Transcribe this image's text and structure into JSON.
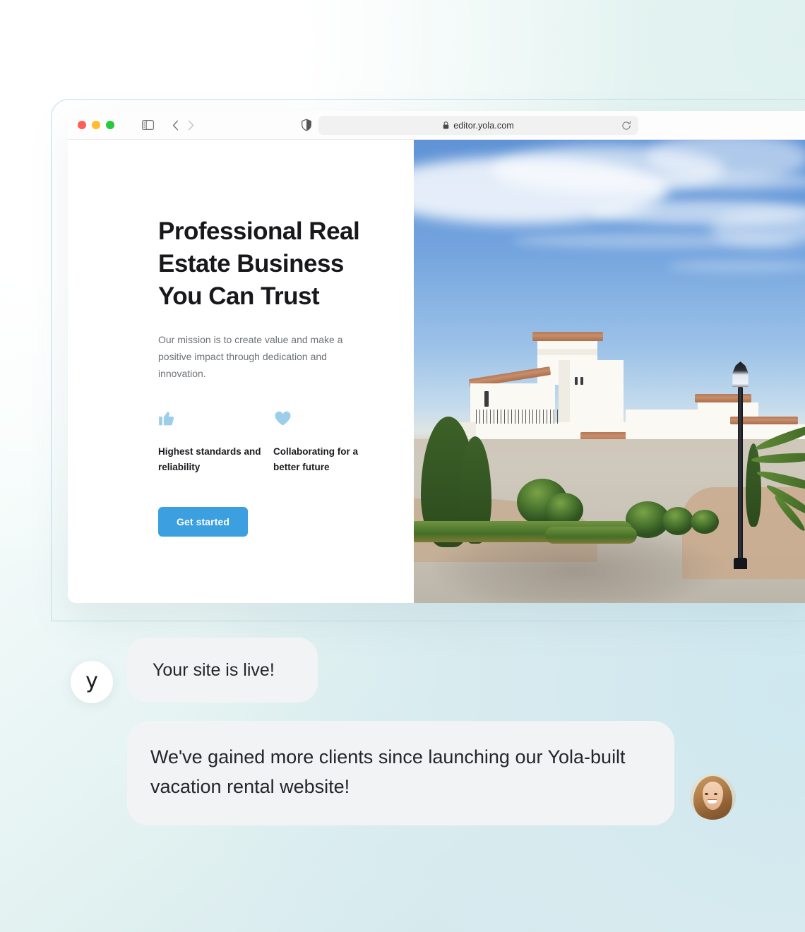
{
  "browser": {
    "traffic_lights": [
      {
        "name": "close",
        "color": "#ff5f57"
      },
      {
        "name": "minimize",
        "color": "#febc2e"
      },
      {
        "name": "zoom",
        "color": "#28c840"
      }
    ],
    "sidebar_toggle_icon": "sidebar-icon",
    "back_icon": "chevron-left-icon",
    "forward_icon": "chevron-right-icon",
    "shield_icon": "shield-icon",
    "lock_icon": "lock-icon",
    "reload_icon": "reload-icon",
    "url": "editor.yola.com"
  },
  "site": {
    "heading": "Professional Real Estate Business You Can Trust",
    "paragraph": "Our mission is to create value and make a positive impact through dedication and innovation.",
    "features": [
      {
        "icon": "thumbs-up-icon",
        "label": "Highest standards and reliability"
      },
      {
        "icon": "heart-icon",
        "label": "Collaborating for a better future"
      }
    ],
    "cta_label": "Get started",
    "hero_image_alt": "white mediterranean villas on a paved resort street with palms and a lamp post"
  },
  "chat": {
    "yola_logo": "y",
    "messages": [
      {
        "from": "yola",
        "text": "Your site is live!"
      },
      {
        "from": "customer",
        "text": "We've gained more clients since launching our Yola-built vacation rental website!"
      }
    ],
    "customer_avatar_alt": "smiling woman with light brown hair"
  },
  "colors": {
    "accent_blue": "#3b9fe0",
    "feature_icon_blue": "#9ccdea",
    "bubble_grey": "#f2f3f4",
    "heading_dark": "#18181c",
    "body_grey": "#6d7278"
  }
}
